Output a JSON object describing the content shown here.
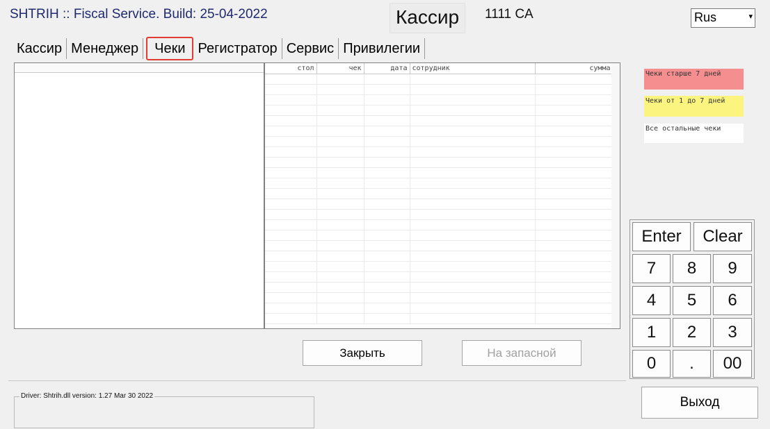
{
  "header": {
    "app_title": "SHTRIH :: Fiscal Service.  Build: 25-04-2022",
    "user_role": "Кассир",
    "user_code": "1111  CA",
    "language": "Rus"
  },
  "tabs": [
    {
      "label": "Кассир"
    },
    {
      "label": "Менеджер"
    },
    {
      "label": "Чеки",
      "active": true
    },
    {
      "label": "Регистратор"
    },
    {
      "label": "Сервис"
    },
    {
      "label": "Привилегии"
    }
  ],
  "grid": {
    "columns": [
      "стол",
      "чек",
      "дата",
      "сотрудник",
      "сумма"
    ]
  },
  "legend": {
    "older_7": "Чеки старше 7 дней",
    "from_1_to_7": "Чеки от 1 до 7 дней",
    "others": "Все остальные чеки"
  },
  "actions": {
    "close": "Закрыть",
    "to_reserve": "На запасной",
    "exit": "Выход"
  },
  "keypad": {
    "enter": "Enter",
    "clear": "Clear",
    "keys": [
      "7",
      "8",
      "9",
      "4",
      "5",
      "6",
      "1",
      "2",
      "3",
      "0",
      ".",
      "00"
    ]
  },
  "driver": {
    "info": "Driver: Shtrih.dll  version: 1.27 Mar 30 2022"
  },
  "colors": {
    "title": "#1f2a6e",
    "legend_red": "#f58e8e",
    "legend_yellow": "#fbf580",
    "active_tab_border": "#e03c31"
  }
}
